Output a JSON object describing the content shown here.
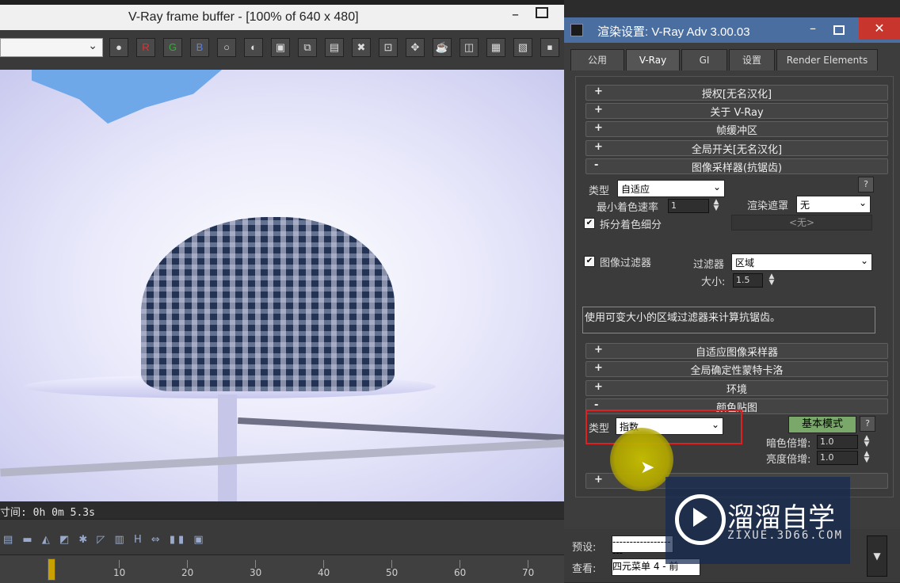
{
  "vfb": {
    "title": "V-Ray frame buffer - [100% of 640 x 480]",
    "window_controls": {
      "minimize": "–",
      "maximize": ""
    },
    "toolbar": {
      "channel_select_value": "",
      "channel_buttons": {
        "red": "R",
        "green": "G",
        "blue": "B"
      }
    },
    "status": {
      "render_time": "寸间: 0h 0m 5.3s"
    },
    "timeline": {
      "ticks": [
        "10",
        "20",
        "30",
        "40",
        "50",
        "60",
        "70"
      ]
    },
    "bottom_tools_label": "H"
  },
  "dialog": {
    "title": "渲染设置: V-Ray Adv 3.00.03",
    "window_controls": {
      "minimize": "–",
      "maximize": "",
      "close": "✕"
    },
    "tabs": [
      "公用",
      "V-Ray",
      "GI",
      "设置",
      "Render Elements"
    ],
    "rollouts": [
      {
        "sign": "+",
        "label": "授权[无名汉化]"
      },
      {
        "sign": "+",
        "label": "关于 V-Ray"
      },
      {
        "sign": "+",
        "label": "帧缓冲区"
      },
      {
        "sign": "+",
        "label": "全局开关[无名汉化]"
      },
      {
        "sign": "-",
        "label": "图像采样器(抗锯齿)"
      }
    ],
    "image_sampler": {
      "type_label": "类型",
      "type_value": "自适应",
      "min_shading_label": "最小着色速率",
      "min_shading_value": "1",
      "render_mask_label": "渲染遮罩",
      "render_mask_value": "无",
      "divide_shading_label": "拆分着色细分",
      "divide_shading_checked": "✔",
      "none_field": "<无>",
      "help": "?"
    },
    "image_filter": {
      "enabled_label": "图像过滤器",
      "enabled_checked": "✔",
      "filter_label": "过滤器",
      "filter_value": "区域",
      "size_label": "大小:",
      "size_value": "1.5",
      "description": "使用可变大小的区域过滤器来计算抗锯齿。"
    },
    "more_rollouts": [
      {
        "sign": "+",
        "label": "自适应图像采样器"
      },
      {
        "sign": "+",
        "label": "全局确定性蒙特卡洛"
      },
      {
        "sign": "+",
        "label": "环境"
      },
      {
        "sign": "-",
        "label": "颜色贴图"
      }
    ],
    "color_mapping": {
      "type_label": "类型",
      "type_value": "指数",
      "mode_button": "基本模式",
      "help": "?",
      "dark_mult_label": "暗色倍增:",
      "dark_mult_value": "1.0",
      "bright_mult_label": "亮度倍增:",
      "bright_mult_value": "1.0"
    },
    "collapsed_bottom_rollout_sign": "+",
    "bottom": {
      "preset_label": "预设:",
      "preset_value": "--------------------",
      "view_label": "查看:",
      "view_value": "四元菜单 4 - 前"
    }
  },
  "watermark": {
    "cn": "溜溜自学",
    "en": "ZIXUE.3D66.COM"
  }
}
